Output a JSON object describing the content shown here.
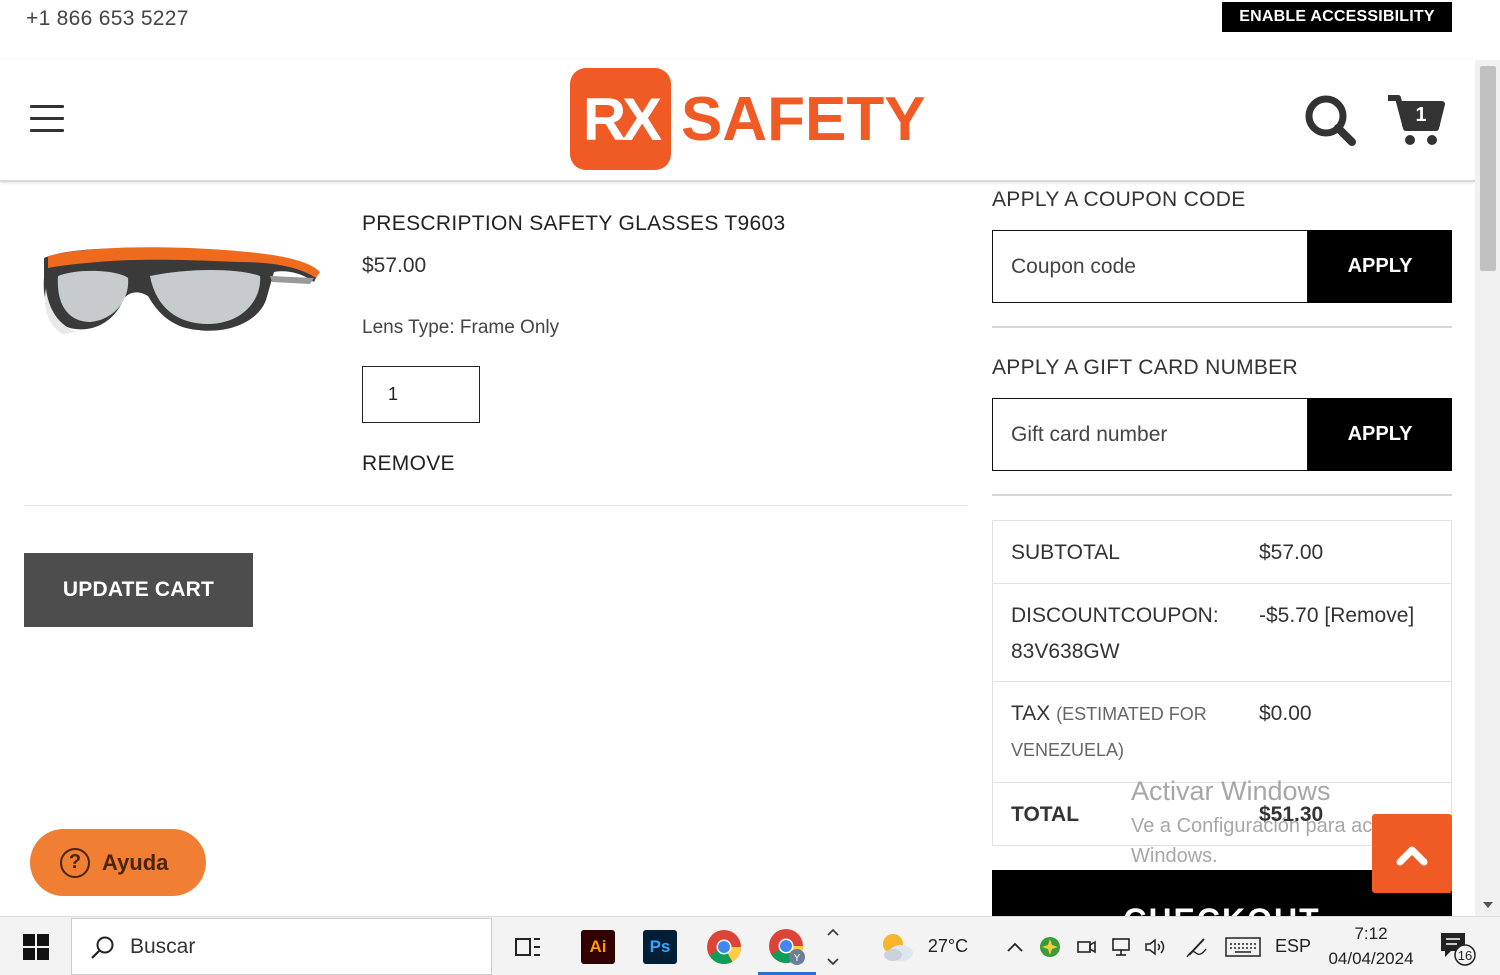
{
  "topbar": {
    "phone": "+1 866 653 5227",
    "accessibility_label": "ENABLE ACCESSIBILITY"
  },
  "header": {
    "logo_mark": "RX",
    "logo_text": "SAFETY",
    "cart_count": "1"
  },
  "cart_item": {
    "title": "PRESCRIPTION SAFETY GLASSES T9603",
    "price": "$57.00",
    "lens_type": "Lens Type: Frame Only",
    "quantity": "1",
    "remove_label": "REMOVE"
  },
  "update_cart_label": "UPDATE CART",
  "coupon": {
    "heading": "APPLY A COUPON CODE",
    "placeholder": "Coupon code",
    "apply_label": "APPLY"
  },
  "gift_card": {
    "heading": "APPLY A GIFT CARD NUMBER",
    "placeholder": "Gift card number",
    "apply_label": "APPLY"
  },
  "totals": {
    "subtotal_label": "SUBTOTAL",
    "subtotal_value": "$57.00",
    "discount_label": "DISCOUNTCOUPON:",
    "discount_code": "83V638GW",
    "discount_value": "-$5.70 [Remove]",
    "tax_label": "TAX",
    "tax_note": "(ESTIMATED FOR VENEZUELA)",
    "tax_value": "$0.00",
    "total_label": "TOTAL",
    "total_value": "$51.30"
  },
  "checkout_label": "CHECKOUT",
  "help_label": "Ayuda",
  "windows_watermark": {
    "line1": "Activar Windows",
    "line2": "Ve a Configuración para activar",
    "line3": "Windows."
  },
  "taskbar": {
    "search_placeholder": "Buscar",
    "weather": "27°C",
    "language": "ESP",
    "time": "7:12",
    "date": "04/04/2024",
    "notification_count": "16",
    "apps": [
      "Ai",
      "Ps"
    ]
  },
  "colors": {
    "brand_orange": "#f05a24",
    "help_orange": "#f07f33",
    "dark_button": "#4d4d4d",
    "black": "#000000"
  }
}
